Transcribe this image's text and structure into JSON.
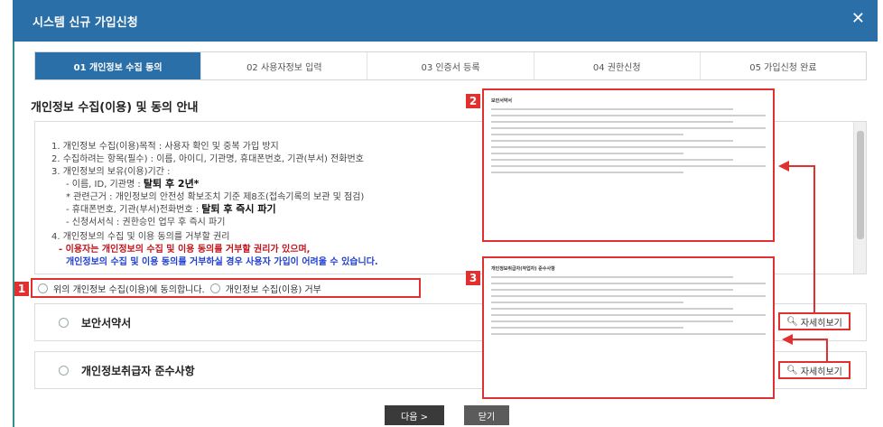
{
  "dialog": {
    "title": "시스템 신규 가입신청",
    "close_glyph": "✕"
  },
  "steps": [
    {
      "label": "01 개인정보 수집 동의",
      "active": true
    },
    {
      "label": "02 사용자정보 입력",
      "active": false
    },
    {
      "label": "03 인증서 등록",
      "active": false
    },
    {
      "label": "04 권한신청",
      "active": false
    },
    {
      "label": "05 가입신청 완료",
      "active": false
    }
  ],
  "section_title": "개인정보 수집(이용) 및 동의 안내",
  "terms": {
    "line1": "1. 개인정보 수집(이용)목적 : 사용자 확인 및 중복 가입 방지",
    "line2": "2. 수집하려는 항목(필수) : 이름, 아이디, 기관명, 휴대폰번호, 기관(부서) 전화번호",
    "line3": "3. 개인정보의 보유(이용)기간 :",
    "line4a": "- 이름, ID, 기관명 : ",
    "line4b": "탈퇴 후 2년*",
    "line5": "* 관련근거 : 개인정보의 안전성 확보조치 기준 제8조(접속기록의 보관 및 점검)",
    "line6a": "- 휴대폰번호, 기관(부서)전화번호 : ",
    "line6b": "탈퇴 후 즉시 파기",
    "line7": "- 신청서서식 : 권한승인 업무 후 즉시 파기",
    "line8": "4. 개인정보의 수집 및 이용 동의를 거부할 권리",
    "line9": "- 이용자는 개인정보의 수집 및 이용 동의를 거부할 권리가 있으며,",
    "line10": "개인정보의 수집 및 이용 동의를 거부하실 경우 사용자 가입이 어려울 수 있습니다."
  },
  "agree": {
    "badge": "1",
    "agree_label": "위의 개인정보 수집(이용)에 동의합니다.",
    "refuse_label": "개인정보 수집(이용) 거부"
  },
  "rows": [
    {
      "label": "보안서약서",
      "detail": "자세히보기"
    },
    {
      "label": "개인정보취급자 준수사항",
      "detail": "자세히보기"
    }
  ],
  "popups": {
    "p2_badge": "2",
    "p2_title": "보안서약서",
    "p3_badge": "3",
    "p3_title": "개인정보취급자(작업자) 준수사항"
  },
  "buttons": {
    "next": "다음 >",
    "close": "닫기"
  },
  "colors": {
    "header": "#2b6fa8",
    "accent_red": "#e03030",
    "active_step": "#2b6fa8"
  }
}
